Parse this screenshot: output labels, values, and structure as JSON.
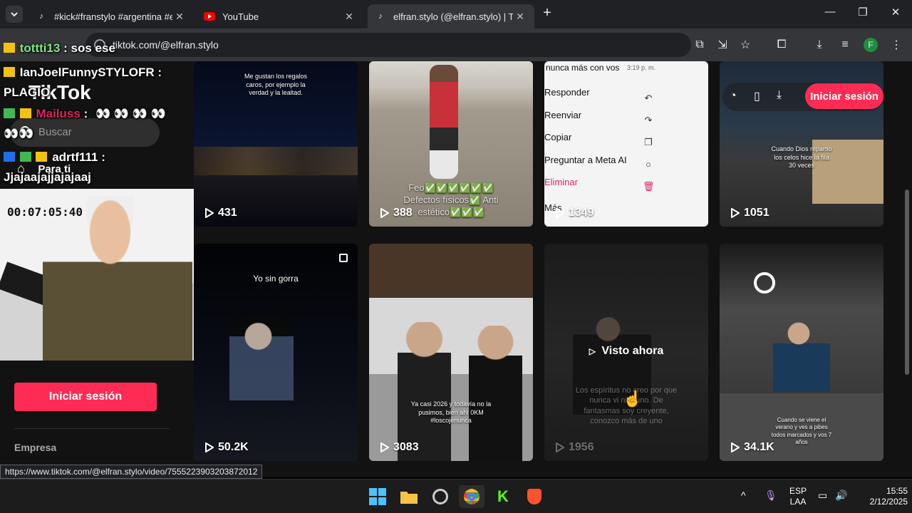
{
  "browser": {
    "tabs": [
      {
        "title": "#kick#franstylo #argentina #ext",
        "icon": "tiktok-icon",
        "active": false
      },
      {
        "title": "YouTube",
        "icon": "youtube-icon",
        "active": false
      },
      {
        "title": "elfran.stylo (@elfran.stylo) | TikT",
        "icon": "tiktok-icon",
        "active": true
      }
    ],
    "new_tab": "+",
    "address": "tiktok.com/@elfran.stylo",
    "profile_initial": "F",
    "status_url": "https://www.tiktok.com/@elfran.stylo/video/7555223903203872012"
  },
  "tiktok": {
    "logo": "TikTok",
    "search_placeholder": "Buscar",
    "nav_for_you": "Para ti",
    "login_label": "Iniciar sesión",
    "footer_company": "Empresa",
    "top_login_label": "Iniciar sesión"
  },
  "videos": [
    {
      "views": "431",
      "caption": "Me gustan los regalos caros, por ejemplo la verdad y la lealtad."
    },
    {
      "views": "388",
      "caption": "Feo✅✅✅✅✅✅ Defectos físicos✅ Anti estético✅✅✅"
    },
    {
      "views": "1349",
      "caption": ""
    },
    {
      "views": "1051",
      "caption": "Cuando Dios repartió los celos hice la fila 30 veces"
    },
    {
      "views": "50.2K",
      "caption": "Yo sin gorra"
    },
    {
      "views": "3083",
      "caption": "Ya casi 2026 y todavía no la pusimos, bien ahí 0KM #loscojenunca"
    },
    {
      "views": "1956",
      "caption": "Los espíritus no creo por que nunca vi ninguno. De fantasmas soy creyente, conozco más de uno",
      "overlay": "Visto ahora"
    },
    {
      "views": "34.1K",
      "caption": "Cuando se viene el verano y ves a pibes todos marcados y vos 7 años"
    }
  ],
  "chat_menu": {
    "header_time": "3:19 p. m.",
    "header_text": "nunca más con vos",
    "items": [
      "Responder",
      "Reenviar",
      "Copiar",
      "Preguntar a Meta AI",
      "Eliminar",
      "Más"
    ]
  },
  "stream": {
    "timer": "00:07:05:40",
    "chat": [
      {
        "user": "tottti13",
        "msg": ": sos ese",
        "color": "#7ee787"
      },
      {
        "user": "IanJoelFunnySTYLOFR",
        "msg": ":",
        "color": "#ffffff"
      },
      {
        "user": "",
        "msg": "PLAGIO",
        "color": "#ffffff"
      },
      {
        "user": "Mailuss",
        "msg": ":",
        "color": "#e0245e"
      },
      {
        "user": "adrtf111",
        "msg": ":",
        "color": "#ffffff"
      },
      {
        "user": "",
        "msg": "Jjajaajajjajajaaj",
        "color": "#ffffff"
      }
    ]
  },
  "taskbar": {
    "lang_top": "ESP",
    "lang_bottom": "LAA",
    "time": "15:55",
    "date": "2/12/2025"
  },
  "colors": {
    "tiktok_red": "#fe2c55",
    "chrome_dark": "#202124",
    "toolbar": "#35363a"
  }
}
